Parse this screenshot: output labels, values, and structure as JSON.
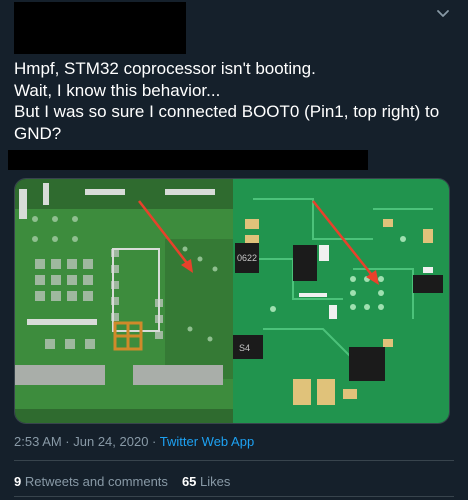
{
  "tweet": {
    "lines": [
      "Hmpf, STM32 coprocessor isn't booting.",
      "Wait, I know this behavior...",
      "But I was so sure I connected BOOT0 (Pin1, top right) to",
      "GND?"
    ],
    "chip_labels": [
      "0622",
      "S4"
    ],
    "timestamp": "2:53 AM · Jun 24, 2020 ·",
    "source_app": "Twitter Web App",
    "retweets_count": "9",
    "retweets_label": "Retweets and comments",
    "likes_count": "65",
    "likes_label": "Likes"
  },
  "colors": {
    "background": "#15202b",
    "muted_text": "#8899a6",
    "link": "#1da1f2",
    "arrow": "#e8412b"
  },
  "icons": [
    "chevron-down-icon"
  ]
}
